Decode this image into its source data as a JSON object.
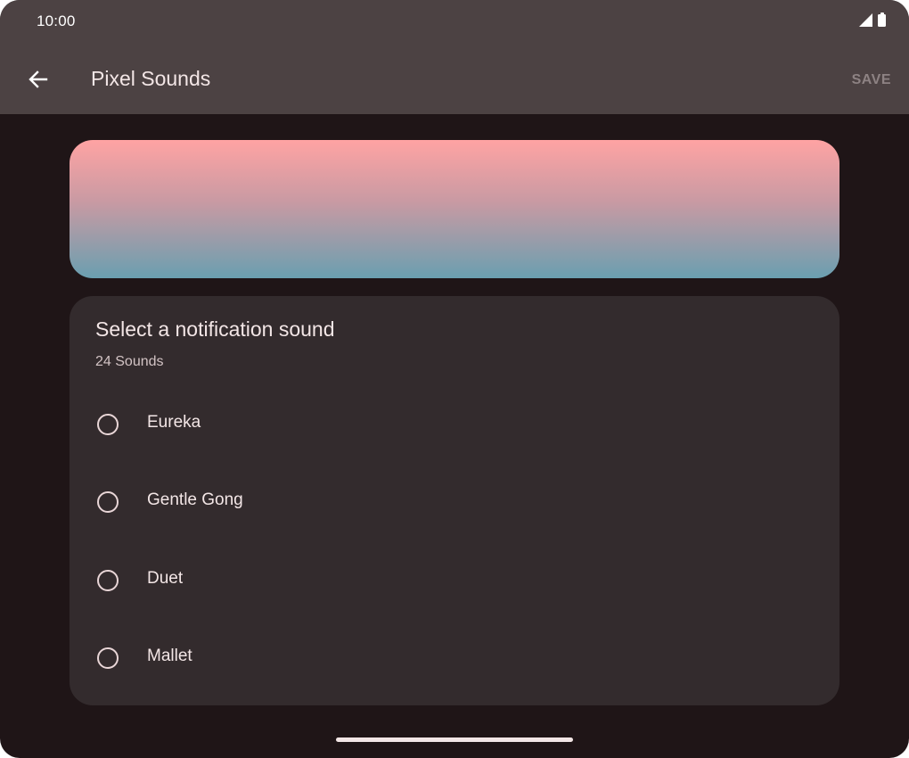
{
  "status_bar": {
    "time": "10:00",
    "icons": [
      "signal-icon",
      "battery-icon"
    ]
  },
  "app_bar": {
    "back_icon": "arrow-back-icon",
    "title": "Pixel Sounds",
    "save_label": "SAVE"
  },
  "banner": {
    "gradient_colors": [
      "#ffa3a3",
      "#c89aa3",
      "#6a9fb0"
    ]
  },
  "card": {
    "title": "Select a notification sound",
    "subtitle": "24 Sounds",
    "options": [
      {
        "label": "Eureka",
        "selected": false
      },
      {
        "label": "Gentle Gong",
        "selected": false
      },
      {
        "label": "Duet",
        "selected": false
      },
      {
        "label": "Mallet",
        "selected": false
      }
    ]
  },
  "colors": {
    "background": "#1f1517",
    "app_bar": "#4c4243",
    "card": "#332b2d",
    "text_primary": "#f3e6e6",
    "text_secondary": "#d2c3c4",
    "save_disabled": "#8d8283"
  }
}
